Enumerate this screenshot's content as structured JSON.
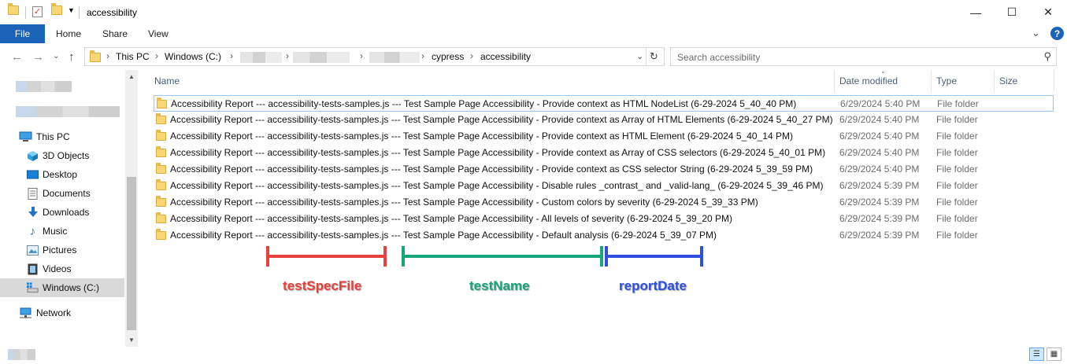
{
  "window": {
    "title": "accessibility",
    "minimize_glyph": "—",
    "maximize_glyph": "☐",
    "close_glyph": "✕"
  },
  "ribbon": {
    "tabs": [
      {
        "label": "File"
      },
      {
        "label": "Home"
      },
      {
        "label": "Share"
      },
      {
        "label": "View"
      }
    ],
    "help_glyph": "?"
  },
  "address": {
    "crumbs": [
      "This PC",
      "Windows  (C:)",
      "cypress",
      "accessibility"
    ],
    "search_placeholder": "Search accessibility"
  },
  "sidebar": {
    "items": [
      {
        "label": "This PC",
        "icon": "computer-icon"
      },
      {
        "label": "3D Objects",
        "icon": "3d-objects-icon"
      },
      {
        "label": "Desktop",
        "icon": "desktop-icon"
      },
      {
        "label": "Documents",
        "icon": "documents-icon"
      },
      {
        "label": "Downloads",
        "icon": "downloads-icon"
      },
      {
        "label": "Music",
        "icon": "music-icon"
      },
      {
        "label": "Pictures",
        "icon": "pictures-icon"
      },
      {
        "label": "Videos",
        "icon": "videos-icon"
      },
      {
        "label": "Windows  (C:)",
        "icon": "drive-icon",
        "selected": true
      },
      {
        "label": "Network",
        "icon": "network-icon"
      }
    ]
  },
  "filelist": {
    "columns": {
      "name": "Name",
      "date": "Date modified",
      "type": "Type",
      "size": "Size"
    },
    "rows": [
      {
        "name": "Accessibility Report --- accessibility-tests-samples.js --- Test Sample Page Accessibility - Provide context as HTML NodeList (6-29-2024 5_40_40 PM)",
        "date": "6/29/2024 5:40 PM",
        "type": "File folder"
      },
      {
        "name": "Accessibility Report --- accessibility-tests-samples.js --- Test Sample Page Accessibility - Provide context as Array of HTML Elements (6-29-2024 5_40_27 PM)",
        "date": "6/29/2024 5:40 PM",
        "type": "File folder"
      },
      {
        "name": "Accessibility Report --- accessibility-tests-samples.js --- Test Sample Page Accessibility - Provide context as HTML Element (6-29-2024 5_40_14 PM)",
        "date": "6/29/2024 5:40 PM",
        "type": "File folder"
      },
      {
        "name": "Accessibility Report --- accessibility-tests-samples.js --- Test Sample Page Accessibility - Provide context as Array of CSS selectors (6-29-2024 5_40_01 PM)",
        "date": "6/29/2024 5:40 PM",
        "type": "File folder"
      },
      {
        "name": "Accessibility Report --- accessibility-tests-samples.js --- Test Sample Page Accessibility - Provide context as CSS selector String (6-29-2024 5_39_59 PM)",
        "date": "6/29/2024 5:40 PM",
        "type": "File folder"
      },
      {
        "name": "Accessibility Report --- accessibility-tests-samples.js --- Test Sample Page Accessibility - Disable rules _contrast_ and _valid-lang_ (6-29-2024 5_39_46 PM)",
        "date": "6/29/2024 5:39 PM",
        "type": "File folder"
      },
      {
        "name": "Accessibility Report --- accessibility-tests-samples.js --- Test Sample Page Accessibility - Custom colors by severity (6-29-2024 5_39_33 PM)",
        "date": "6/29/2024 5:39 PM",
        "type": "File folder"
      },
      {
        "name": "Accessibility Report --- accessibility-tests-samples.js --- Test Sample Page Accessibility - All levels of severity (6-29-2024 5_39_20 PM)",
        "date": "6/29/2024 5:39 PM",
        "type": "File folder"
      },
      {
        "name": "Accessibility Report --- accessibility-tests-samples.js --- Test Sample Page Accessibility - Default analysis (6-29-2024 5_39_07 PM)",
        "date": "6/29/2024 5:39 PM",
        "type": "File folder"
      }
    ]
  },
  "annotations": [
    {
      "label": "testSpecFile",
      "color": "#e8403c"
    },
    {
      "label": "testName",
      "color": "#17a57a"
    },
    {
      "label": "reportDate",
      "color": "#2f4fe0"
    }
  ]
}
